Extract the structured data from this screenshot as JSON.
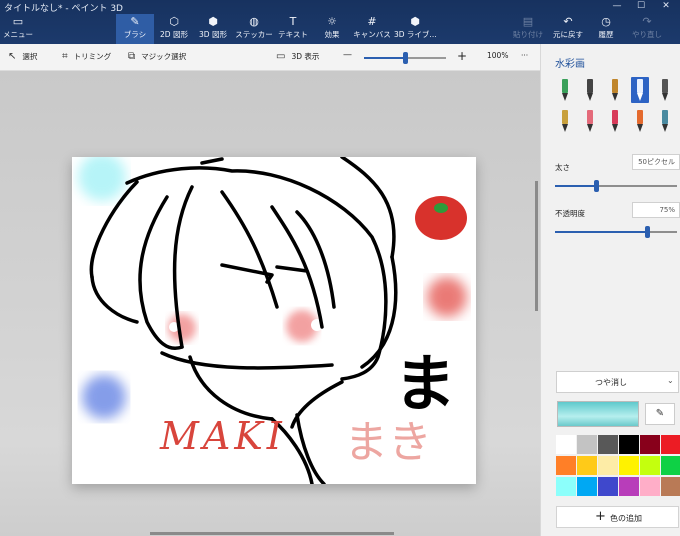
{
  "window": {
    "title": "タイトルなし* - ペイント 3D",
    "controls": [
      "—",
      "☐",
      "✕"
    ]
  },
  "ribbon": {
    "menu": "メニュー",
    "tabs": [
      {
        "label": "ブラシ",
        "icon": "brush-icon",
        "glyph": "✎"
      },
      {
        "label": "2D 図形",
        "icon": "shapes-2d-icon",
        "glyph": "⬡"
      },
      {
        "label": "3D 図形",
        "icon": "cube-icon",
        "glyph": "⬢"
      },
      {
        "label": "ステッカー",
        "icon": "sticker-icon",
        "glyph": "◍"
      },
      {
        "label": "テキスト",
        "icon": "text-icon",
        "glyph": "T"
      },
      {
        "label": "効果",
        "icon": "effects-icon",
        "glyph": "☼"
      },
      {
        "label": "キャンバス",
        "icon": "canvas-icon",
        "glyph": "#"
      },
      {
        "label": "3D ライブ...",
        "icon": "library-3d-icon",
        "glyph": "⬢"
      }
    ],
    "actions": [
      {
        "label": "貼り付け",
        "icon": "paste-icon",
        "glyph": "▤"
      },
      {
        "label": "元に戻す",
        "icon": "undo-icon",
        "glyph": "↶"
      },
      {
        "label": "履歴",
        "icon": "history-icon",
        "glyph": "◷"
      },
      {
        "label": "やり直し",
        "icon": "redo-icon",
        "glyph": "↷"
      }
    ]
  },
  "toolbar": {
    "select": "選択",
    "crop": "トリミング",
    "magic_select": "マジック選択",
    "view_3d": "3D 表示",
    "zoom_out": "—",
    "zoom_in": "+",
    "zoom": "100%",
    "more": "···",
    "zoom_fraction": 0.5
  },
  "canvas": {
    "text_roman": "MAKI",
    "text_kana": "まき",
    "text_big": "ま"
  },
  "panel": {
    "title": "水彩画",
    "brushes": [
      {
        "name": "marker-icon",
        "color": "#3aa05a"
      },
      {
        "name": "calligraphy-pen-icon",
        "color": "#444444"
      },
      {
        "name": "oil-brush-icon",
        "color": "#c0862c"
      },
      {
        "name": "watercolor-icon",
        "color": "#e8f0ff"
      },
      {
        "name": "pixel-pen-icon",
        "color": "#555555"
      },
      {
        "name": "pencil-icon",
        "color": "#c8a03c"
      },
      {
        "name": "eraser-icon",
        "color": "#e46a7a"
      },
      {
        "name": "crayon-icon",
        "color": "#d83b5a"
      },
      {
        "name": "spray-can-icon",
        "color": "#e46a2e"
      },
      {
        "name": "fill-bucket-icon",
        "color": "#4a8aa0"
      }
    ],
    "thickness_label": "太さ",
    "thickness_value": "50ピクセル",
    "thickness_fraction": 0.34,
    "opacity_label": "不透明度",
    "opacity_value": "75%",
    "opacity_fraction": 0.75,
    "finish": "つや消し",
    "current_color": "#8ed8da",
    "palette": [
      "#ffffff",
      "#c3c3c3",
      "#585858",
      "#000000",
      "#88001b",
      "#ec1c24",
      "#ff7f27",
      "#ffca18",
      "#fdeca6",
      "#fff200",
      "#c4ff0e",
      "#0ed145",
      "#8cfffb",
      "#00a8f3",
      "#3f48cc",
      "#b83dba",
      "#ffaec8",
      "#b97a56"
    ],
    "add_color": "色の追加"
  }
}
